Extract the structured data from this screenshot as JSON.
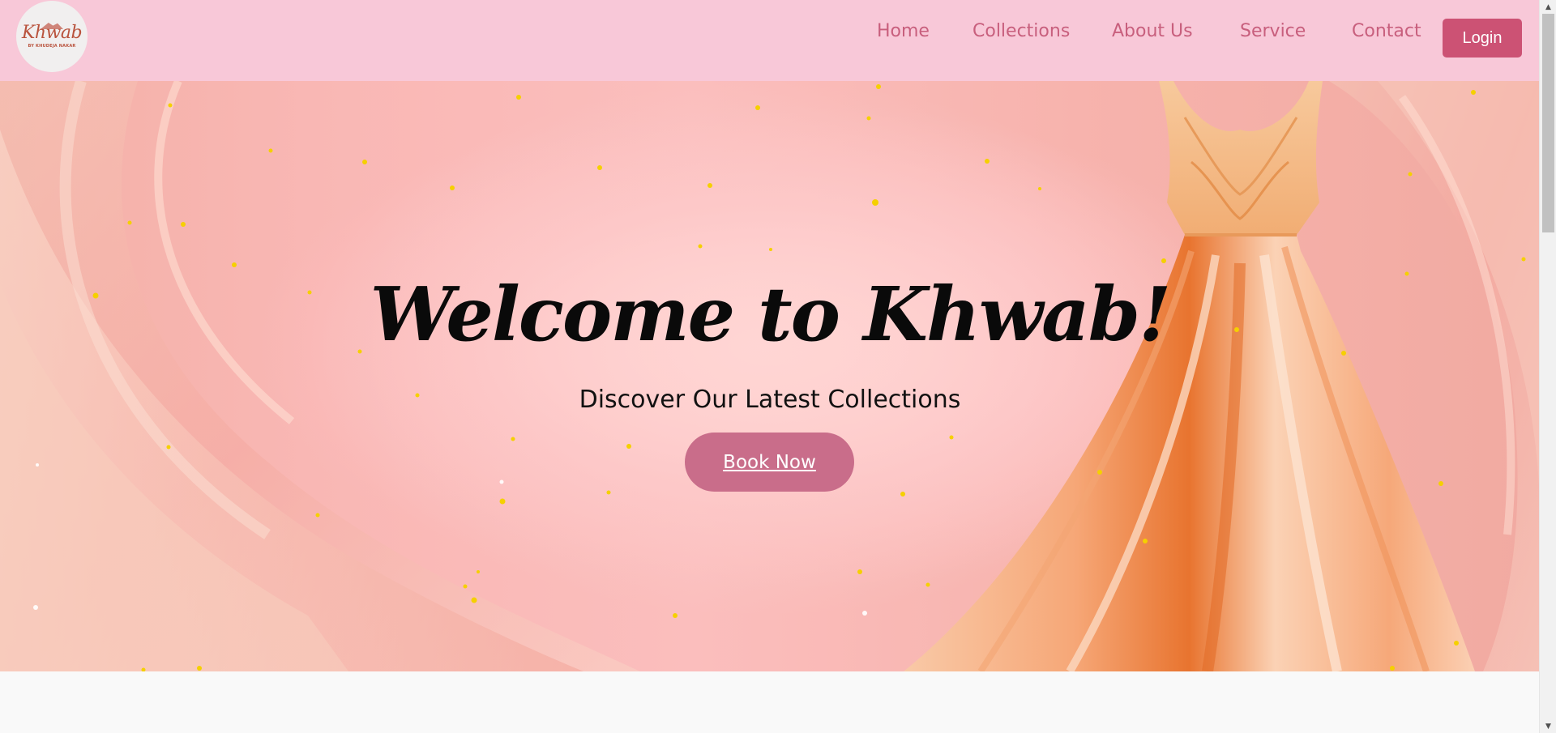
{
  "header": {
    "logo_text": "Khwab",
    "logo_subtext": "BY KHUDEJA NAKAR",
    "nav": [
      {
        "label": "Home"
      },
      {
        "label": "Collections"
      },
      {
        "label": "About Us"
      },
      {
        "label": "Service"
      },
      {
        "label": "Contact"
      }
    ],
    "login_label": "Login"
  },
  "hero": {
    "title": "Welcome to Khwab!",
    "subtitle": "Discover Our Latest Collections",
    "cta_label": "Book Now"
  },
  "colors": {
    "nav_background": "#f8c8d8",
    "nav_link": "#c85f7d",
    "login_button": "#cc5274",
    "cta_button": "#c96d8a",
    "hero_background": "#fbbebd"
  },
  "icons": {
    "logo": "khwab-logo-icon",
    "dress": "gown-dress-icon",
    "scroll_up": "chevron-up-icon",
    "scroll_down": "chevron-down-icon"
  }
}
